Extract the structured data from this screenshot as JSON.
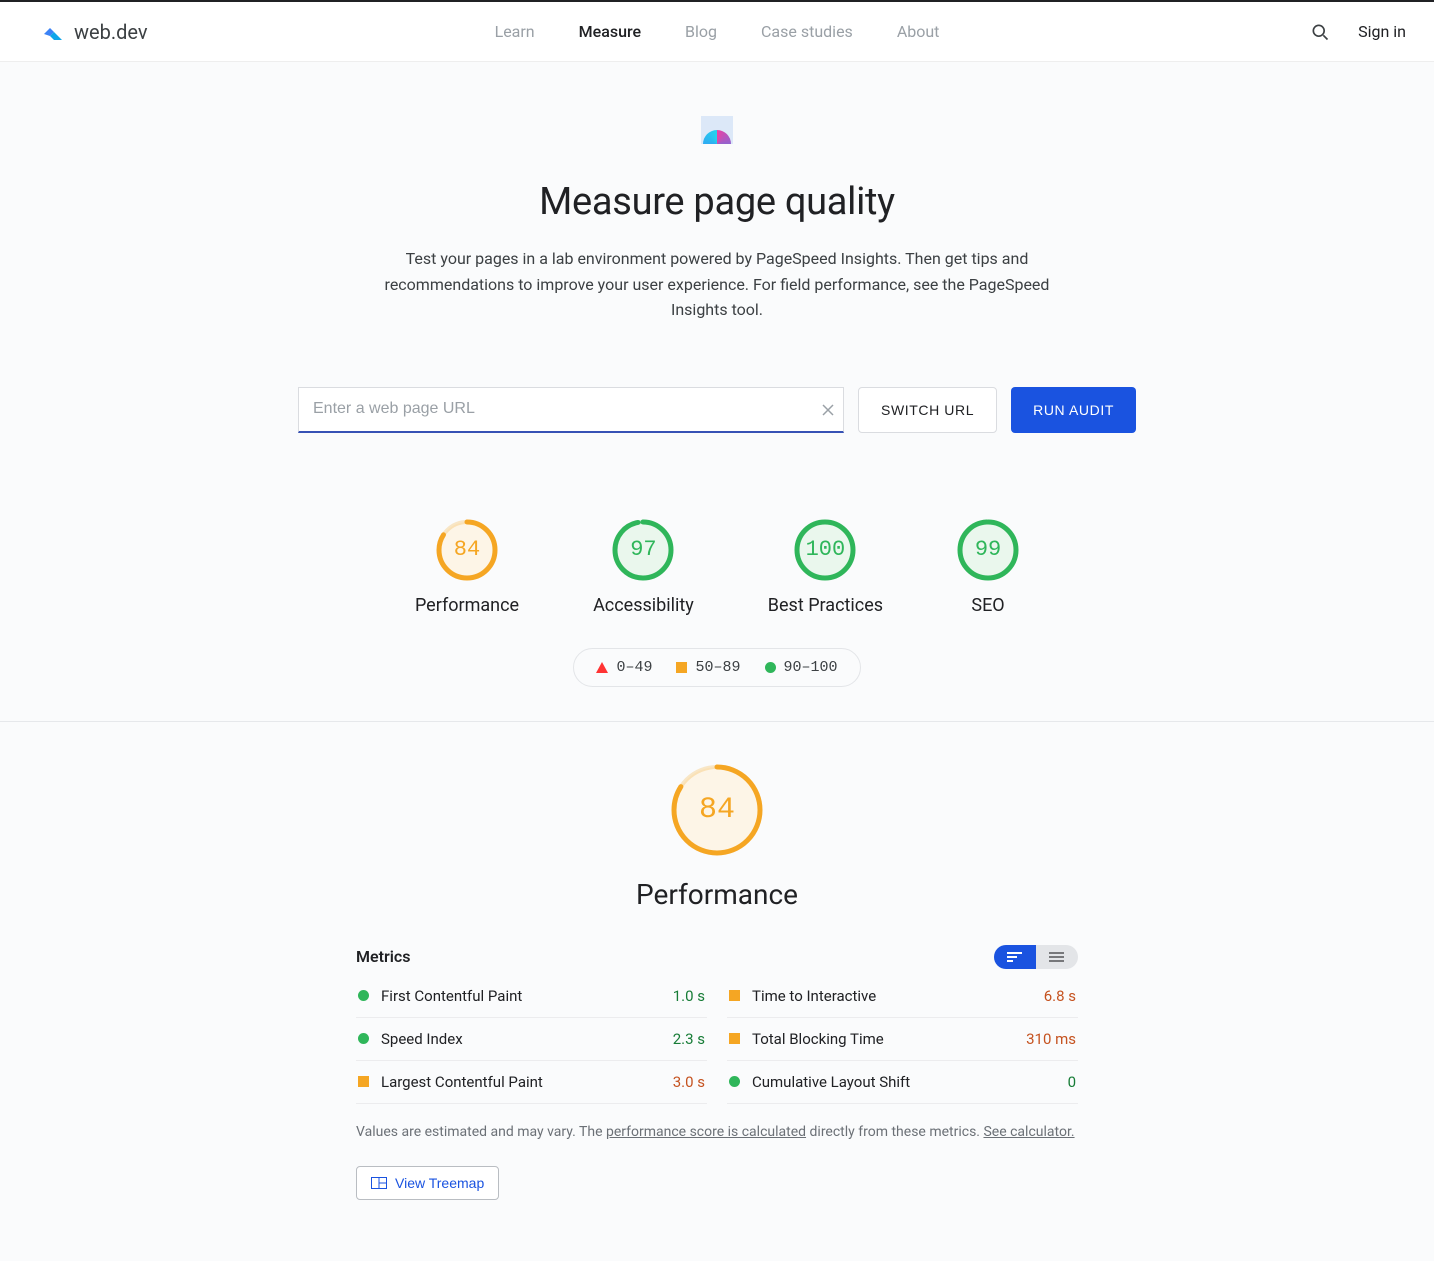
{
  "header": {
    "brand": "web.dev",
    "nav": {
      "learn": "Learn",
      "measure": "Measure",
      "blog": "Blog",
      "case": "Case studies",
      "about": "About"
    },
    "signin": "Sign in"
  },
  "hero": {
    "title": "Measure page quality",
    "subtitle": "Test your pages in a lab environment powered by PageSpeed Insights. Then get tips and recommendations to improve your user experience. For field performance, see the PageSpeed Insights tool.",
    "placeholder": "Enter a web page URL",
    "switch": "SWITCH URL",
    "run": "RUN AUDIT"
  },
  "gauges": [
    {
      "label": "Performance",
      "value": 84,
      "color": "#f5a623"
    },
    {
      "label": "Accessibility",
      "value": 97,
      "color": "#2fb65a"
    },
    {
      "label": "Best Practices",
      "value": 100,
      "color": "#2fb65a"
    },
    {
      "label": "SEO",
      "value": 99,
      "color": "#2fb65a"
    }
  ],
  "legend": {
    "r0": "0–49",
    "r1": "50–89",
    "r2": "90–100"
  },
  "perf": {
    "score": 84,
    "color": "#f5a623",
    "title": "Performance",
    "metrics_label": "Metrics"
  },
  "metrics": [
    {
      "name": "First Contentful Paint",
      "value": "1.0 s",
      "status": "green",
      "col": 0
    },
    {
      "name": "Speed Index",
      "value": "2.3 s",
      "status": "green",
      "col": 0
    },
    {
      "name": "Largest Contentful Paint",
      "value": "3.0 s",
      "status": "orange",
      "col": 0
    },
    {
      "name": "Time to Interactive",
      "value": "6.8 s",
      "status": "orange",
      "col": 1
    },
    {
      "name": "Total Blocking Time",
      "value": "310 ms",
      "status": "orange",
      "col": 1
    },
    {
      "name": "Cumulative Layout Shift",
      "value": "0",
      "status": "green",
      "col": 1
    }
  ],
  "footnote": {
    "pre": "Values are estimated and may vary. The ",
    "link1": "performance score is calculated",
    "mid": " directly from these metrics. ",
    "link2": "See calculator."
  },
  "treemap": "View Treemap"
}
